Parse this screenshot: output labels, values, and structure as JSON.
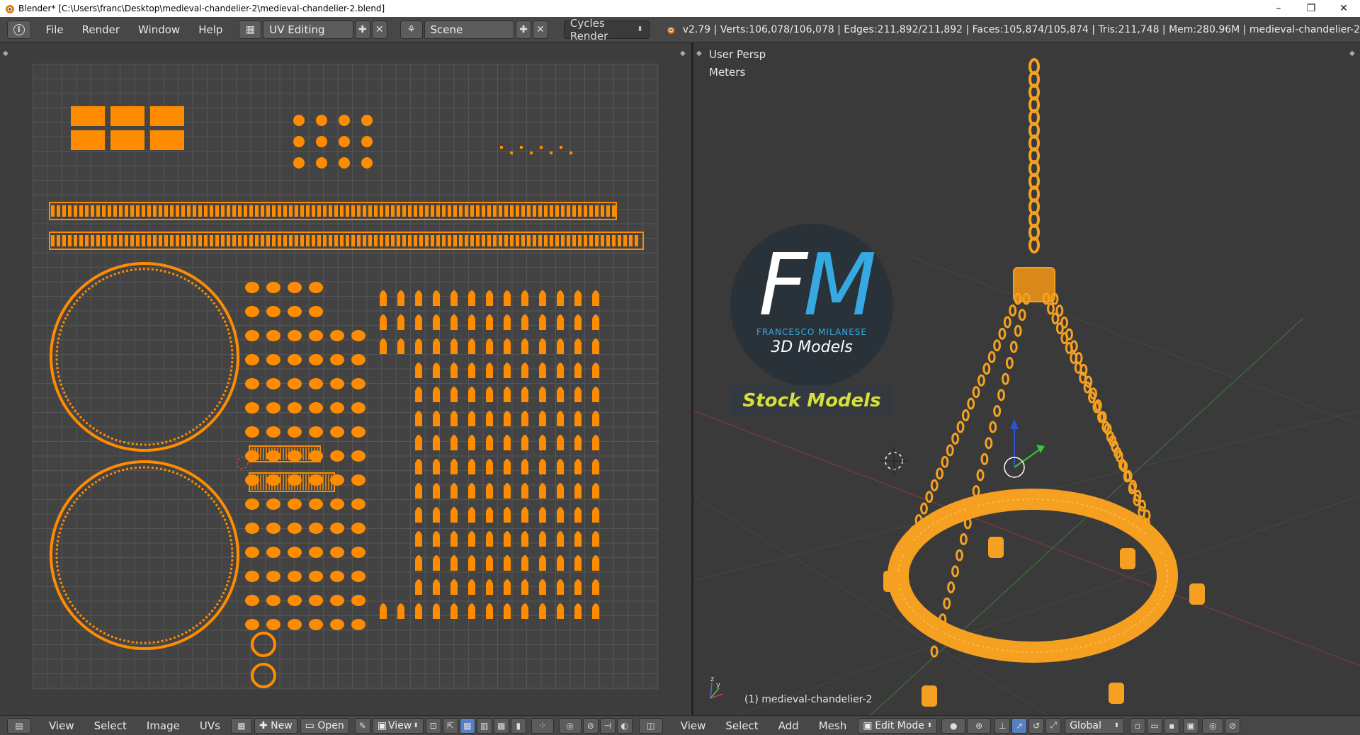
{
  "titlebar": {
    "title": "Blender* [C:\\Users\\franc\\Desktop\\medieval-chandelier-2\\medieval-chandelier-2.blend]",
    "minimize": "–",
    "restore": "❐",
    "close": "✕"
  },
  "topbar": {
    "info_icon": "i",
    "menus": [
      "File",
      "Render",
      "Window",
      "Help"
    ],
    "screen_layout": "UV Editing",
    "scene": "Scene",
    "render_engine": "Cycles Render",
    "stats": "v2.79 | Verts:106,078/106,078 | Edges:211,892/211,892 | Faces:105,874/105,874 | Tris:211,748 | Mem:280.96M | medieval-chandelier-2"
  },
  "viewport": {
    "persp_label": "User Persp",
    "units_label": "Meters",
    "object_label": "(1) medieval-chandelier-2"
  },
  "watermark": {
    "letter_f": "F",
    "letter_m": "M",
    "name": "FRANCESCO MILANESE",
    "subtitle": "3D Models",
    "stock": "Stock Models"
  },
  "uv_bottombar": {
    "menus": [
      "View",
      "Select",
      "Image",
      "UVs"
    ],
    "new_label": "New",
    "open_label": "Open",
    "view_label": "View"
  },
  "view3d_bottombar": {
    "menus": [
      "View",
      "Select",
      "Add",
      "Mesh"
    ],
    "mode": "Edit Mode",
    "orientation": "Global"
  },
  "colors": {
    "uv_orange": "#ff8c00",
    "wire_orange": "#f5a020",
    "accent_blue": "#35a9e0",
    "stock_yellow": "#d6e03a"
  }
}
